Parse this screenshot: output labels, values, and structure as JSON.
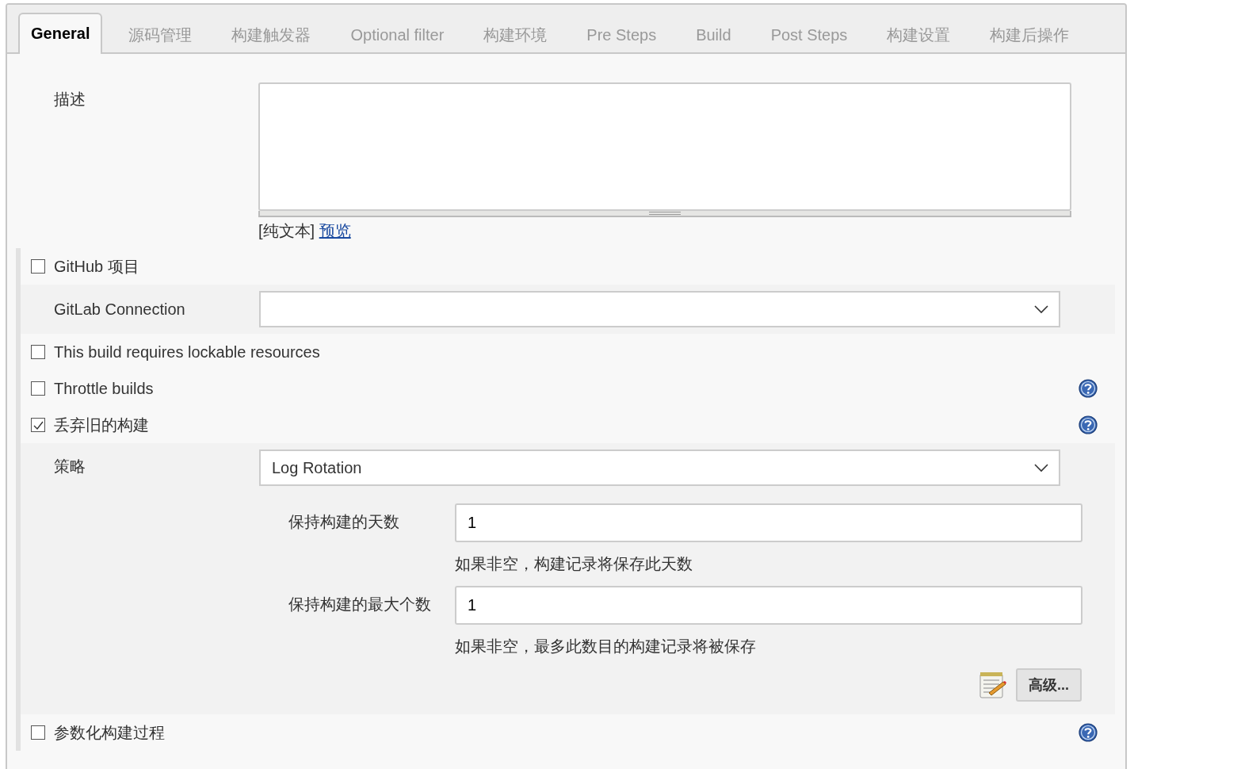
{
  "tabs": [
    {
      "label": "General",
      "selected": true
    },
    {
      "label": "源码管理",
      "selected": false
    },
    {
      "label": "构建触发器",
      "selected": false
    },
    {
      "label": "Optional filter",
      "selected": false
    },
    {
      "label": "构建环境",
      "selected": false
    },
    {
      "label": "Pre Steps",
      "selected": false
    },
    {
      "label": "Build",
      "selected": false
    },
    {
      "label": "Post Steps",
      "selected": false
    },
    {
      "label": "构建设置",
      "selected": false
    },
    {
      "label": "构建后操作",
      "selected": false
    }
  ],
  "description": {
    "label": "描述",
    "markup_note": "[纯文本]",
    "preview_link": "预览"
  },
  "options": [
    {
      "kind": "checkbox",
      "label": "GitHub 项目",
      "checked": false,
      "help": false
    },
    {
      "kind": "select",
      "label": "GitLab Connection"
    },
    {
      "kind": "checkbox",
      "label": "This build requires lockable resources",
      "checked": false,
      "help": false
    },
    {
      "kind": "checkbox",
      "label": "Throttle builds",
      "checked": false,
      "help": true
    },
    {
      "kind": "checkbox",
      "label": "丢弃旧的构建",
      "checked": true,
      "help": true,
      "details": {
        "strategy_label": "策略",
        "strategy_value": "Log Rotation",
        "fields": [
          {
            "label": "保持构建的天数",
            "value": "1",
            "hint": "如果非空，构建记录将保存此天数"
          },
          {
            "label": "保持构建的最大个数",
            "value": "1",
            "hint": "如果非空，最多此数目的构建记录将被保存"
          }
        ],
        "advanced_button": "高级..."
      }
    },
    {
      "kind": "checkbox",
      "label": "参数化构建过程",
      "checked": false,
      "help": true
    }
  ]
}
